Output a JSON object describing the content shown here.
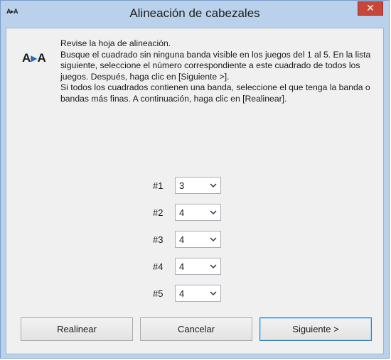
{
  "window": {
    "title": "Alineación de cabezales",
    "title_icon": "A▸A",
    "close_label": "✕"
  },
  "content": {
    "icon": "alignment-icon",
    "paragraphs": [
      "Revise la hoja de alineación.",
      "Busque el cuadrado sin ninguna banda visible en los juegos del 1 al 5. En la lista siguiente, seleccione el número correspondiente a este cuadrado de todos los juegos. Después, haga clic en [Siguiente >].",
      "Si todos los cuadrados contienen una banda, seleccione el que tenga la banda o bandas más finas. A continuación, haga clic en [Realinear]."
    ]
  },
  "selectors": [
    {
      "label": "#1",
      "value": "3"
    },
    {
      "label": "#2",
      "value": "4"
    },
    {
      "label": "#3",
      "value": "4"
    },
    {
      "label": "#4",
      "value": "4"
    },
    {
      "label": "#5",
      "value": "4"
    }
  ],
  "buttons": {
    "realign": "Realinear",
    "cancel": "Cancelar",
    "next": "Siguiente >"
  },
  "colors": {
    "titlebar": "#b9d1ea",
    "close": "#c7463a",
    "client": "#f0f0f0",
    "accent": "#3c7fb1"
  }
}
